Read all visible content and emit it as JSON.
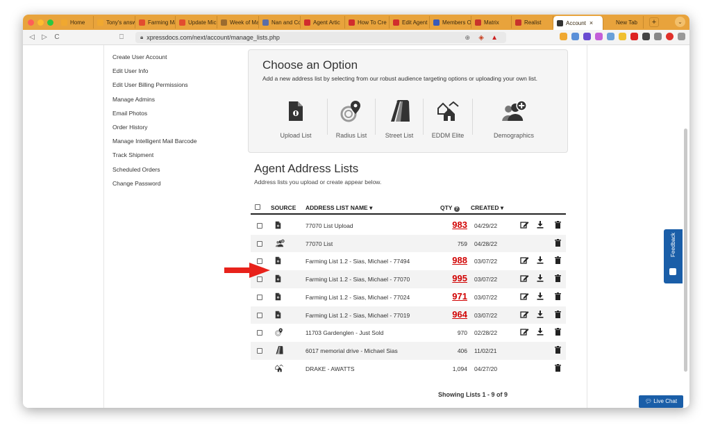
{
  "browser": {
    "tabs": [
      {
        "label": "Home",
        "color": "#f0a830"
      },
      {
        "label": "Tony's answ",
        "color": "#f0a830"
      },
      {
        "label": "Farming Ma",
        "color": "#e24c2f"
      },
      {
        "label": "Update Mic",
        "color": "#e24c2f"
      },
      {
        "label": "Week of Ma",
        "color": "#9b6b2f"
      },
      {
        "label": "Nan and Co",
        "color": "#5b6ea8"
      },
      {
        "label": "Agent Artic",
        "color": "#d12d2d"
      },
      {
        "label": "How To Cre",
        "color": "#d12d2d"
      },
      {
        "label": "Edit Agent",
        "color": "#d12d2d"
      },
      {
        "label": "Members O",
        "color": "#3a5bb8"
      },
      {
        "label": "Matrix",
        "color": "#c8332b"
      },
      {
        "label": "Realist",
        "color": "#c8332b"
      },
      {
        "label": "Account",
        "color": "#333333",
        "active": true
      },
      {
        "label": "New Tab",
        "color": "#e8a33c"
      }
    ],
    "url": "xpressdocs.com/next/account/manage_lists.php"
  },
  "sidebar": {
    "items": [
      "Create User Account",
      "Edit User Info",
      "Edit User Billing Permissions",
      "Manage Admins",
      "Email Photos",
      "Order History",
      "Manage Intelligent Mail Barcode",
      "Track Shipment",
      "Scheduled Orders",
      "Change Password"
    ]
  },
  "options": {
    "title": "Choose an Option",
    "description": "Add a new address list by selecting from our robust audience targeting options or uploading your own list.",
    "items": [
      {
        "label": "Upload List",
        "icon": "upload-file-icon"
      },
      {
        "label": "Radius List",
        "icon": "radius-pin-icon"
      },
      {
        "label": "Street List",
        "icon": "street-road-icon"
      },
      {
        "label": "EDDM Elite",
        "icon": "houses-icon"
      },
      {
        "label": "Demographics",
        "icon": "people-plus-icon"
      }
    ]
  },
  "lists": {
    "title": "Agent Address Lists",
    "subtitle": "Address lists you upload or create appear below.",
    "headers": {
      "source": "SOURCE",
      "name": "ADDRESS LIST NAME ▾",
      "qty": "QTY",
      "created": "CREATED ▾"
    },
    "rows": [
      {
        "source": "upload",
        "name": "77070 List Upload",
        "qty": "983",
        "qty_red": true,
        "created": "04/29/22",
        "edit": true,
        "download": true,
        "checkbox": true
      },
      {
        "source": "demographics",
        "name": "77070 List",
        "qty": "759",
        "qty_red": false,
        "created": "04/28/22",
        "edit": false,
        "download": false,
        "checkbox": true
      },
      {
        "source": "upload",
        "name": "Farming List 1.2 - Sias, Michael - 77494",
        "qty": "988",
        "qty_red": true,
        "created": "03/07/22",
        "edit": true,
        "download": true,
        "checkbox": true
      },
      {
        "source": "upload",
        "name": "Farming List 1.2 - Sias, Michael - 77070",
        "qty": "995",
        "qty_red": true,
        "created": "03/07/22",
        "edit": true,
        "download": true,
        "checkbox": true
      },
      {
        "source": "upload",
        "name": "Farming List 1.2 - Sias, Michael - 77024",
        "qty": "971",
        "qty_red": true,
        "created": "03/07/22",
        "edit": true,
        "download": true,
        "checkbox": true
      },
      {
        "source": "upload",
        "name": "Farming List 1.2 - Sias, Michael - 77019",
        "qty": "964",
        "qty_red": true,
        "created": "03/07/22",
        "edit": true,
        "download": true,
        "checkbox": true
      },
      {
        "source": "radius",
        "name": "11703 Gardenglen - Just Sold",
        "qty": "970",
        "qty_red": false,
        "created": "02/28/22",
        "edit": true,
        "download": true,
        "checkbox": true
      },
      {
        "source": "street",
        "name": "6017 memorial drive - Michael Sias",
        "qty": "406",
        "qty_red": false,
        "created": "11/02/21",
        "edit": false,
        "download": false,
        "checkbox": true
      },
      {
        "source": "houses",
        "name": "DRAKE - AWATTS",
        "qty": "1,094",
        "qty_red": false,
        "created": "04/27/20",
        "edit": false,
        "download": false,
        "checkbox": false
      }
    ],
    "showing": "Showing Lists 1 - 9 of 9"
  },
  "widgets": {
    "feedback": "Feedback",
    "livechat": "Live Chat"
  }
}
